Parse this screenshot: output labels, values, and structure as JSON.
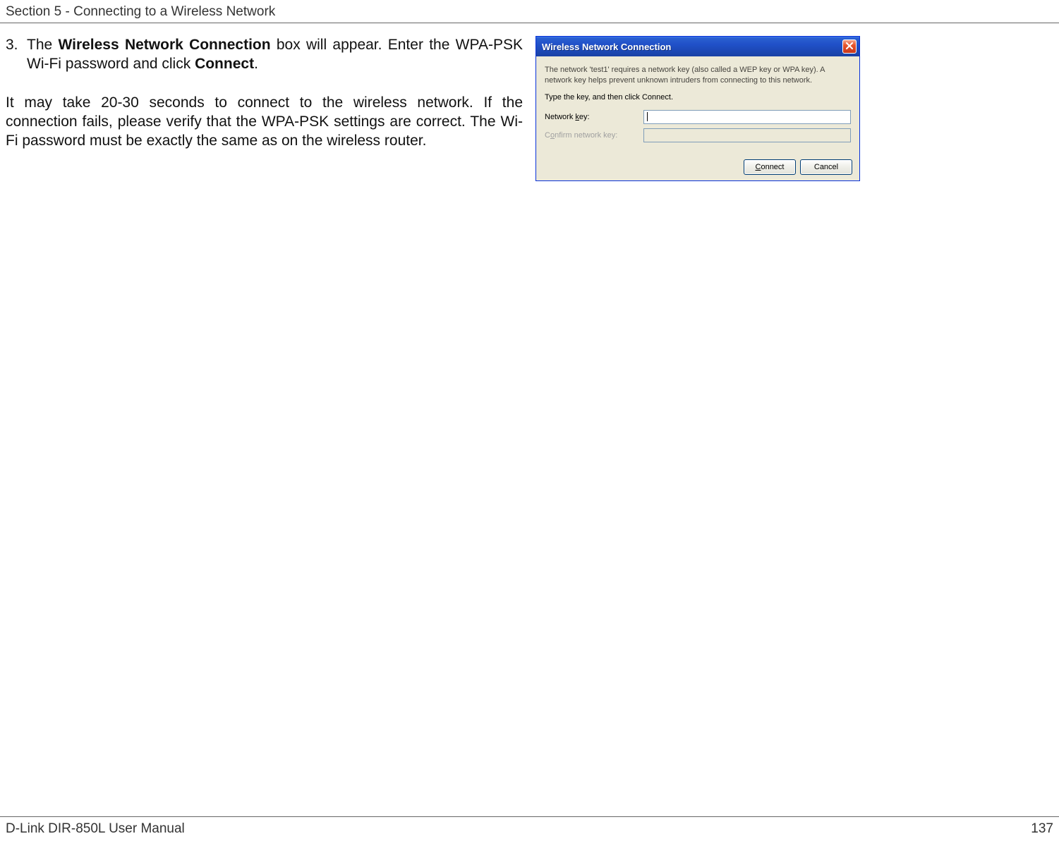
{
  "header": {
    "section_title": "Section 5 - Connecting to a Wireless Network"
  },
  "step": {
    "number": "3.",
    "text_part1": "The ",
    "bold1": "Wireless Network Connection",
    "text_part2": " box will appear. Enter the WPA-PSK Wi-Fi password and click ",
    "bold2": "Connect",
    "text_part3": "."
  },
  "paragraph": {
    "text": "It may take 20-30 seconds to connect to the wireless network. If the connection fails, please verify that the WPA-PSK settings are correct. The Wi-Fi password must be exactly the same as on the wireless router."
  },
  "dialog": {
    "title": "Wireless Network Connection",
    "desc": "The network 'test1' requires a network key (also called a WEP key or WPA key). A network key helps prevent unknown intruders from connecting to this network.",
    "instruction": "Type the key, and then click Connect.",
    "label_network_key_pre": "Network ",
    "label_network_key_u": "k",
    "label_network_key_post": "ey:",
    "label_confirm_pre": "C",
    "label_confirm_u": "o",
    "label_confirm_post": "nfirm network key:",
    "connect_pre": "",
    "connect_u": "C",
    "connect_post": "onnect",
    "cancel_label": "Cancel"
  },
  "footer": {
    "manual": "D-Link DIR-850L User Manual",
    "page": "137"
  }
}
